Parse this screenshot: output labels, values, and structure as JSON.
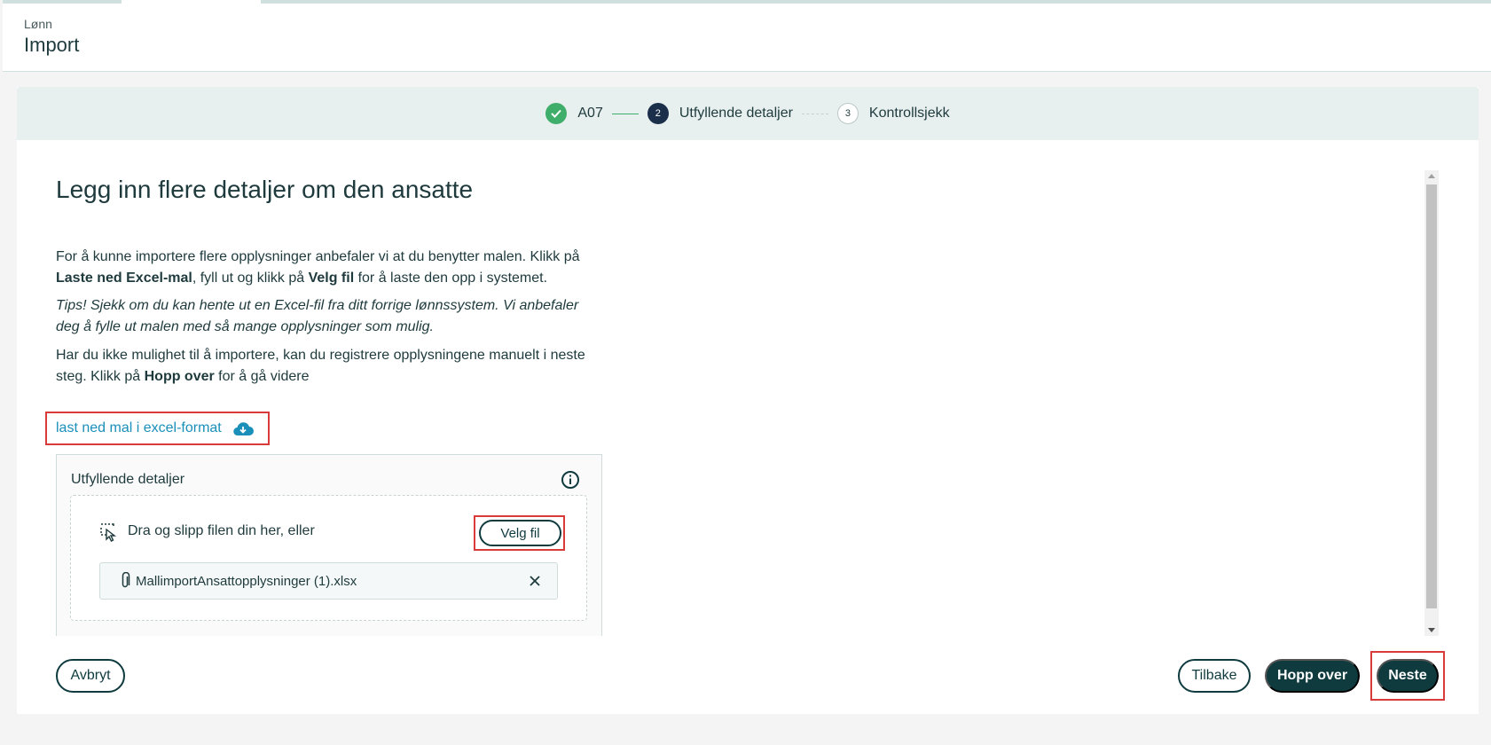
{
  "header": {
    "breadcrumb": "Lønn",
    "title": "Import"
  },
  "stepper": {
    "steps": [
      {
        "number": "",
        "label": "A07",
        "state": "done"
      },
      {
        "number": "2",
        "label": "Utfyllende detaljer",
        "state": "active"
      },
      {
        "number": "3",
        "label": "Kontrollsjekk",
        "state": "todo"
      }
    ]
  },
  "main": {
    "heading": "Legg inn flere detaljer om den ansatte",
    "p1_a": "For å kunne importere flere opplysninger anbefaler vi at du benytter malen. Klikk på ",
    "p1_b": "Laste ned Excel-mal",
    "p1_c": ", fyll ut og klikk på ",
    "p1_d": "Velg fil",
    "p1_e": " for å laste den opp i systemet.",
    "tips": "Tips! Sjekk om du kan hente ut en Excel-fil fra ditt forrige lønnssystem. Vi anbefaler deg å fylle ut malen med så mange opplysninger som mulig.",
    "p3_a": "Har du ikke mulighet til å importere, kan du registrere opplysningene manuelt i neste steg. Klikk på ",
    "p3_b": "Hopp over",
    "p3_c": " for å gå videre",
    "download_link": "last ned mal i excel-format"
  },
  "upload": {
    "title": "Utfyllende detaljer",
    "drop_text": "Dra og slipp filen din her, eller",
    "choose_file": "Velg fil",
    "file_name": "MallimportAnsattopplysninger (1).xlsx"
  },
  "footer": {
    "cancel": "Avbryt",
    "back": "Tilbake",
    "skip": "Hopp over",
    "next": "Neste"
  },
  "colors": {
    "primary": "#0f3b3f",
    "link": "#1a8fb9",
    "success": "#3fae6a",
    "active_step": "#1b2f4a",
    "highlight": "#d93a3a"
  },
  "icons": [
    "check-icon",
    "cloud-download-icon",
    "info-icon",
    "drag-drop-icon",
    "paperclip-icon",
    "close-icon"
  ]
}
